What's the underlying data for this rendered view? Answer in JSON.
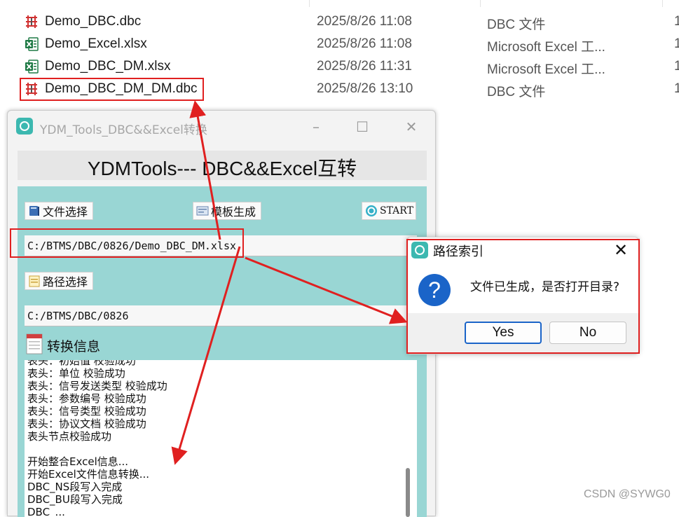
{
  "explorer": {
    "files": [
      {
        "name": "Demo_DBC.dbc",
        "date": "2025/8/26 11:08",
        "type": "DBC 文件",
        "size": "1",
        "icon": "dbc-file-icon"
      },
      {
        "name": "Demo_Excel.xlsx",
        "date": "2025/8/26 11:08",
        "type": "Microsoft Excel 工...",
        "size": "1",
        "icon": "excel-file-icon"
      },
      {
        "name": "Demo_DBC_DM.xlsx",
        "date": "2025/8/26 11:31",
        "type": "Microsoft Excel 工...",
        "size": "1",
        "icon": "excel-file-icon"
      },
      {
        "name": "Demo_DBC_DM_DM.dbc",
        "date": "2025/8/26 13:10",
        "type": "DBC 文件",
        "size": "1",
        "icon": "dbc-file-icon"
      }
    ]
  },
  "app": {
    "title": "YDM_Tools_DBC&&Excel转换",
    "header": "YDMTools--- DBC&&Excel互转",
    "file_select_label": "文件选择",
    "template_label": "模板生成",
    "start_label": "START",
    "file_path": "C:/BTMS/DBC/0826/Demo_DBC_DM.xlsx",
    "path_select_label": "路径选择",
    "dir_path": "C:/BTMS/DBC/0826",
    "info_label": "转换信息",
    "log": [
      "表头：初始值 校验成功",
      "表头：单位 校验成功",
      "表头：信号发送类型 校验成功",
      "表头：参数编号 校验成功",
      "表头：信号类型 校验成功",
      "表头：协议文档 校验成功",
      "表头节点校验成功",
      "",
      "开始整合Excel信息...",
      "开始Excel文件信息转换...",
      "DBC_NS段写入完成",
      "DBC_BU段写入完成",
      "DBC_..."
    ]
  },
  "dialog": {
    "title": "路径索引",
    "message": "文件已生成，是否打开目录?",
    "yes": "Yes",
    "no": "No",
    "icon": "question-icon"
  },
  "watermark": "CSDN @SYWG0",
  "colors": {
    "accent_teal": "#99d6d4",
    "annotation_red": "#e02020",
    "dialog_blue": "#1a64c8"
  }
}
